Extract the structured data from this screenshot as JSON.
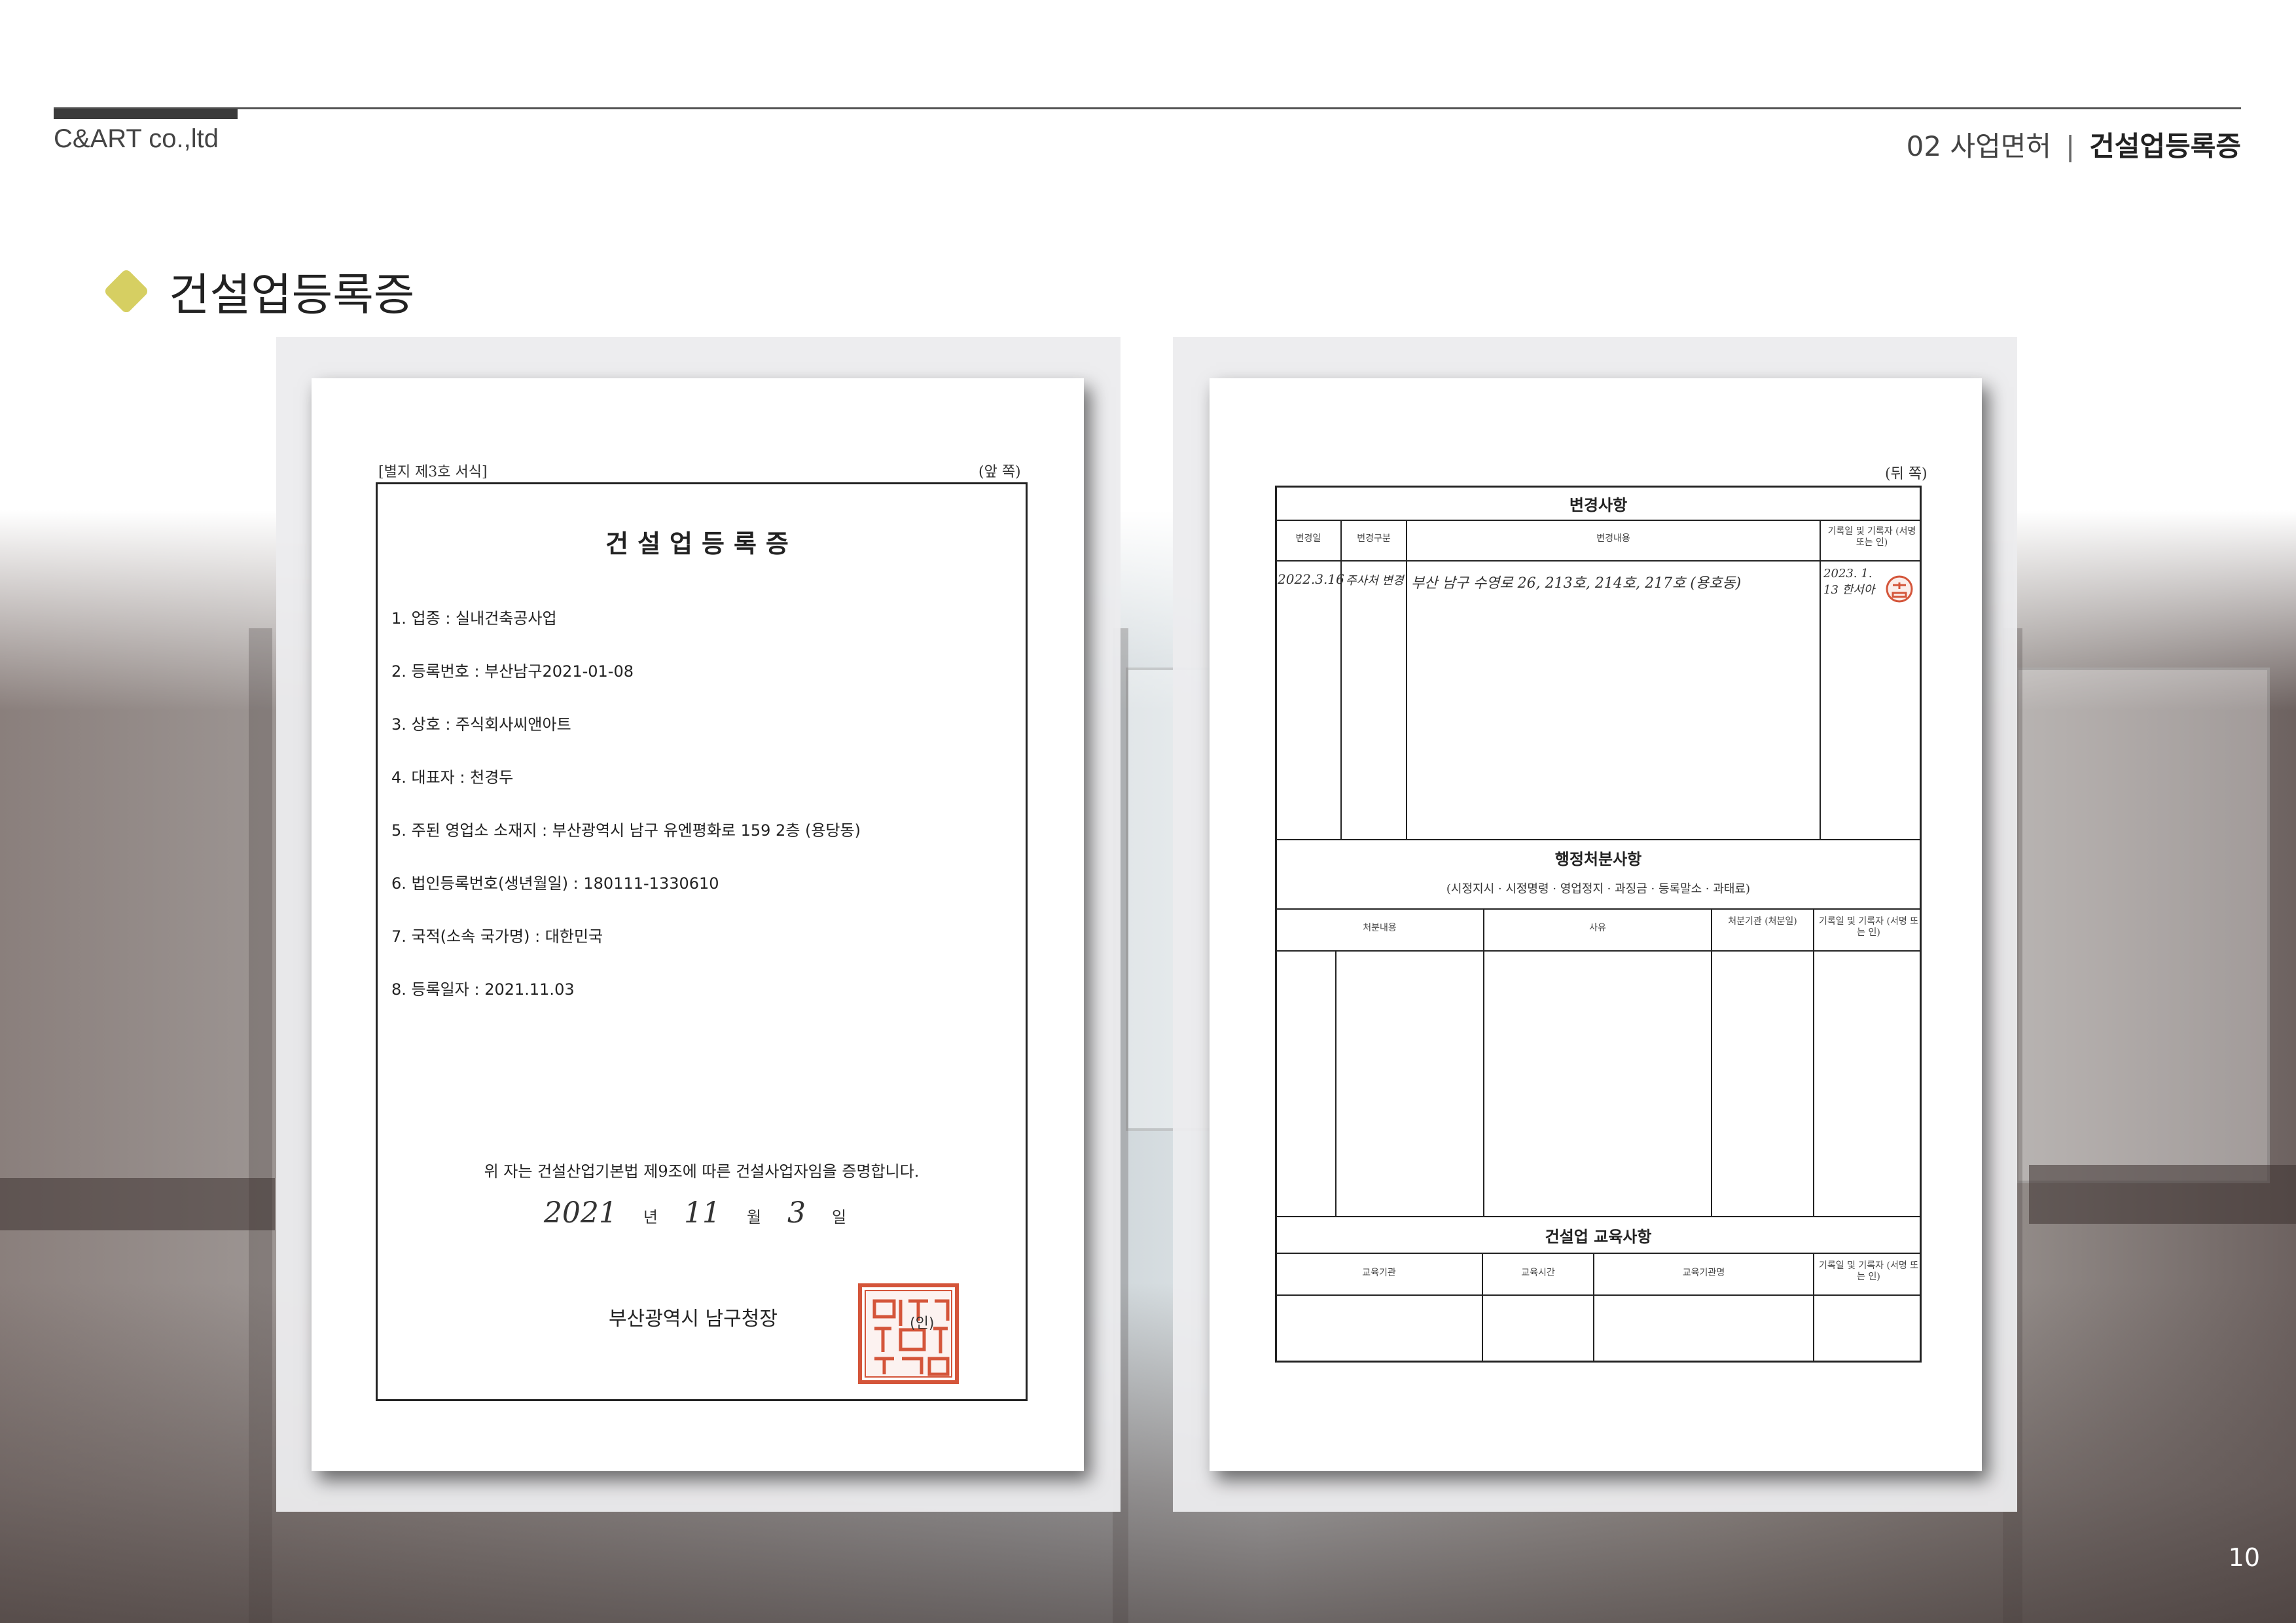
{
  "header": {
    "company": "C&ART co.,ltd",
    "section": "02 사업면허",
    "separator": "|",
    "current": "건설업등록증"
  },
  "page_title": "건설업등록증",
  "certificate_front": {
    "form_no": "[별지 제3호 서식]",
    "side": "(앞 쪽)",
    "title": "건설업등록증",
    "items": [
      "1. 업종 : 실내건축공사업",
      "2. 등록번호 : 부산남구2021-01-08",
      "3. 상호 : 주식회사씨앤아트",
      "4. 대표자 : 천경두",
      "5. 주된 영업소 소재지 : 부산광역시 남구 유엔평화로 159 2층 (용당동)",
      "6. 법인등록번호(생년월일) : 180111-1330610",
      "7. 국적(소속 국가명) : 대한민국",
      "8. 등록일자 : 2021.11.03"
    ],
    "statement": "위 자는 건설산업기본법 제9조에 따른 건설사업자임을 증명합니다.",
    "date": {
      "year": "2021",
      "year_unit": "년",
      "month": "11",
      "month_unit": "월",
      "day": "3",
      "day_unit": "일"
    },
    "issuer": "부산광역시 남구청장",
    "seal_mark": "(인)",
    "seal_color": "#d4553a"
  },
  "certificate_back": {
    "side": "(뒤 쪽)",
    "change_section": {
      "title": "변경사항",
      "headers": [
        "변경일",
        "변경구분",
        "변경내용",
        "기록일 및 기록자 (서명 또는 인)"
      ],
      "row": {
        "date": "2022.3.16",
        "type": "주사처 변경",
        "content": "부산 남구 수영로 26, 213호, 214호, 217호 (용호동)",
        "recorder": "2023. 1. 13 한서아"
      }
    },
    "admin_section": {
      "title": "행정처분사항",
      "subtitle": "(시정지시 · 시정명령 · 영업정지 · 과징금 · 등록말소 · 과태료)",
      "headers": [
        "처분내용",
        "사유",
        "처분기관 (처분일)",
        "기록일 및 기록자 (서명 또는 인)"
      ]
    },
    "education_section": {
      "title": "건설업 교육사항",
      "headers": [
        "교육기관",
        "교육시간",
        "교육기관명",
        "기록일 및 기록자 (서명 또는 인)"
      ]
    }
  },
  "page_number": "10"
}
